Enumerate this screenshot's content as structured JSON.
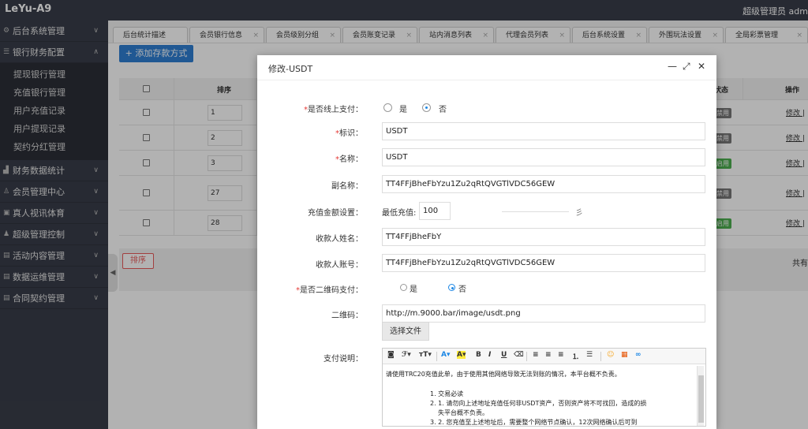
{
  "app": {
    "title": "LeYu-A9",
    "user": "超级管理员  adm"
  },
  "sidebar": {
    "items": [
      {
        "label": "后台系统管理",
        "icon": "gear-icon"
      },
      {
        "label": "银行财务配置",
        "icon": "list-icon",
        "expanded": true
      },
      {
        "label": "财务数据统计",
        "icon": "chart-icon"
      },
      {
        "label": "会员管理中心",
        "icon": "user-icon"
      },
      {
        "label": "真人视讯体育",
        "icon": "video-icon"
      },
      {
        "label": "超级管理控制",
        "icon": "admin-icon"
      },
      {
        "label": "活动内容管理",
        "icon": "calendar-icon"
      },
      {
        "label": "数据运维管理",
        "icon": "database-icon"
      },
      {
        "label": "合同契约管理",
        "icon": "contract-icon"
      }
    ],
    "sub_items": [
      "提现银行管理",
      "充值银行管理",
      "用户充值记录",
      "用户提现记录",
      "契约分红管理"
    ]
  },
  "tabs": [
    "后台统计描述",
    "会员银行信息",
    "会员级别分组",
    "会员账变记录",
    "站内消息列表",
    "代理会员列表",
    "后台系统设置",
    "外围玩法设置",
    "全局彩票管理"
  ],
  "toolbar": {
    "add_label": "+ 添加存款方式"
  },
  "table": {
    "headers": {
      "sort": "排序",
      "status": "状态",
      "ops": "操作"
    },
    "rows": [
      {
        "sort": "1",
        "status": "禁用",
        "ops": "修改 |"
      },
      {
        "sort": "2",
        "status": "禁用",
        "ops": "修改 |"
      },
      {
        "sort": "3",
        "status": "启用",
        "ops": "修改 |"
      },
      {
        "sort": "27",
        "status": "禁用",
        "ops": "修改 |"
      },
      {
        "sort": "28",
        "status": "启用",
        "ops": "修改 |"
      }
    ],
    "sort_button": "排序",
    "total": "共有"
  },
  "modal": {
    "title": "修改-USDT",
    "online": {
      "label": "是否线上支付：",
      "yes": "是",
      "no": "否",
      "value": "no"
    },
    "identifier": {
      "label": "标识：",
      "value": "USDT"
    },
    "name": {
      "label": "名称：",
      "value": "USDT"
    },
    "subname": {
      "label": "副名称：",
      "value": "TT4FFjBheFbYzu1Zu2qRtQVGTlVDC56GEW"
    },
    "amount": {
      "label": "充值金额设置：",
      "min_label": "最低充值:",
      "min_value": "100",
      "max_partial": "彡"
    },
    "payee_name": {
      "label": "收款人姓名：",
      "value": "TT4FFjBheFbY"
    },
    "payee_account": {
      "label": "收款人账号：",
      "value": "TT4FFjBheFbYzu1Zu2qRtQVGTlVDC56GEW"
    },
    "qr_pay": {
      "label": "是否二维码支付：",
      "yes": "是",
      "no": "否",
      "value": "no"
    },
    "qrcode": {
      "label": "二维码：",
      "value": "http://m.9000.bar/image/usdt.png",
      "choose": "选择文件"
    },
    "description": {
      "label": "支付说明：",
      "lines": [
        "请使用TRC20充值此单，由于使用其他网络导致无法到账的情况，本平台概不负责。",
        "1. 交易必读",
        "2. 1. 请勿向上述地址充值任何非USDT资产，否则资产将不可找回，造成的损",
        "失平台概不负责。",
        "3. 2. 您充值至上述地址后，需要整个网络节点确认，12次网络确认后可到"
      ]
    }
  },
  "colors": {
    "topbar": "#393d49",
    "primary": "#2f7fd3",
    "danger": "#e85b5b",
    "success": "#4caf50"
  }
}
